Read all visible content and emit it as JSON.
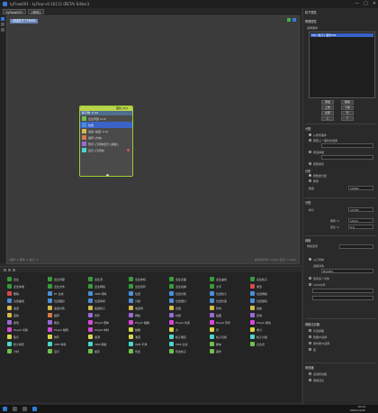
{
  "window": {
    "title": "tyFlow001 - tyFlow v0.16112 (BETA) Editor3",
    "min": "—",
    "max": "□",
    "close": "✕"
  },
  "menu": {
    "tabs": [
      "tyFlow001",
      "[修改]"
    ]
  },
  "graph": {
    "crumb": "创建粒子 TYBIRD",
    "status_left": "操作: 0  事件: 1  粒子: 0",
    "status_right": "操作运行时: 0.000s  显示: 0.000s"
  },
  "node": {
    "header": "事件_001",
    "subheader": "粒子数: 0 (0)",
    "rows": [
      {
        "label": "出生局部 (0-0)",
        "color": "#6fbf4a",
        "sel": false
      },
      {
        "label": "位置",
        "color": "#4a8fd6",
        "sel": true
      },
      {
        "label": "速度 (速度: 0.0)",
        "color": "#d6b84a",
        "sel": false
      },
      {
        "label": "旋转 (方向)",
        "color": "#d67a4a",
        "sel": false
      },
      {
        "label": "形状 (几何体显示 [基础])",
        "color": "#9a6ad6",
        "sel": false
      },
      {
        "label": "显示 (几何体)",
        "color": "#4ad6c8",
        "sel": false
      }
    ]
  },
  "right": {
    "sec1": "粒子属性",
    "sec2": "物理属性",
    "list_header": "选择事件:",
    "list_items": [
      "001 (粒子) 事件001"
    ],
    "btn_add": "添加",
    "btn_remove": "删除",
    "btn_up": "上移",
    "btn_down": "下移",
    "btn_all": "全部",
    "btn_none": "无",
    "btn_a": "上",
    "btn_b": "下",
    "sec3": "分配",
    "opt_a": "从所有事件",
    "opt_b": "按照上一事件的选择",
    "opt_c": "按选择组",
    "opt_d": "按照排序",
    "sec4": "分布",
    "dist_a": "按数量分配",
    "dist_b": "概率",
    "lbl_count": "数量",
    "val_count": "10000",
    "sec5": "分配",
    "lbl_seed": "种子",
    "val_seed": "12345",
    "lbl_prob": "概率 %",
    "val_prob": "100.0",
    "lbl_var": "变化 %",
    "val_var": "0.0",
    "sec6": "网格",
    "mesh_hdr": "网格选项",
    "mesh_a": "从几何体",
    "mesh_b": "选择对象",
    "mesh_field": "Box001",
    "mesh_c": "使用多个对象",
    "mesh_d": "mtlib文件",
    "sec7": "网格过滤器",
    "f1": "仅选择面",
    "f2": "按面ID选择",
    "f3": "按材质ID选择",
    "f4": "组",
    "sec8": "修改器",
    "m1": "应用修改器",
    "m2": "保留顶点"
  },
  "ops": [
    {
      "label": "出生",
      "c": "#3a9a3a"
    },
    {
      "label": "出生局部",
      "c": "#3a9a3a"
    },
    {
      "label": "出生流",
      "c": "#3a9a3a"
    },
    {
      "label": "出生体积",
      "c": "#3a9a3a"
    },
    {
      "label": "出生表面",
      "c": "#3a9a3a"
    },
    {
      "label": "出生曲线",
      "c": "#3a9a3a"
    },
    {
      "label": "出生粒子",
      "c": "#3a9a3a"
    },
    {
      "label": "出生体素",
      "c": "#3a9a3a"
    },
    {
      "label": "出生文件",
      "c": "#3a9a3a"
    },
    {
      "label": "出生网格",
      "c": "#3a9a3a"
    },
    {
      "label": "出生形状",
      "c": "#3a9a3a"
    },
    {
      "label": "出生绘制",
      "c": "#3a9a3a"
    },
    {
      "label": "文字",
      "c": "#3a9a3a"
    },
    {
      "label": "重置",
      "c": "#d64a4a"
    },
    {
      "label": "删除",
      "c": "#d64a4a"
    },
    {
      "label": "PT 生成",
      "c": "#4a8fd6"
    },
    {
      "label": "VDB 转换",
      "c": "#4a8fd6"
    },
    {
      "label": "位置",
      "c": "#4a8fd6"
    },
    {
      "label": "位置对象",
      "c": "#4a8fd6"
    },
    {
      "label": "位置粒子",
      "c": "#4a8fd6"
    },
    {
      "label": "位置网格",
      "c": "#4a8fd6"
    },
    {
      "label": "位置曲线",
      "c": "#4a8fd6"
    },
    {
      "label": "位置图标",
      "c": "#4a8fd6"
    },
    {
      "label": "位置体积",
      "c": "#4a8fd6"
    },
    {
      "label": "分组",
      "c": "#4a8fd6"
    },
    {
      "label": "位置细分",
      "c": "#4a8fd6"
    },
    {
      "label": "位置约束",
      "c": "#4a8fd6"
    },
    {
      "label": "位置随机",
      "c": "#4a8fd6"
    },
    {
      "label": "速度",
      "c": "#d6b84a"
    },
    {
      "label": "速度对象",
      "c": "#d6b84a"
    },
    {
      "label": "速度粒子",
      "c": "#d6b84a"
    },
    {
      "label": "速度场",
      "c": "#d6b84a"
    },
    {
      "label": "自旋",
      "c": "#d6b84a"
    },
    {
      "label": "转向",
      "c": "#d6b84a"
    },
    {
      "label": "缩放",
      "c": "#d6b84a"
    },
    {
      "label": "变换",
      "c": "#d6b84a"
    },
    {
      "label": "旋转",
      "c": "#d67a4a"
    },
    {
      "label": "形状",
      "c": "#9a6ad6"
    },
    {
      "label": "网格",
      "c": "#9a6ad6"
    },
    {
      "label": "材质",
      "c": "#9a6ad6"
    },
    {
      "label": "贴图",
      "c": "#9a6ad6"
    },
    {
      "label": "实例",
      "c": "#9a6ad6"
    },
    {
      "label": "颜色",
      "c": "#9a6ad6"
    },
    {
      "label": "属性",
      "c": "#9a6ad6"
    },
    {
      "label": "PhysX 刚体",
      "c": "#d64ad6"
    },
    {
      "label": "PhysX 碰撞",
      "c": "#d64ad6"
    },
    {
      "label": "PhysX 约束",
      "c": "#d64ad6"
    },
    {
      "label": "PhysX 形状",
      "c": "#d64ad6"
    },
    {
      "label": "PhysX 属性",
      "c": "#d64ad6"
    },
    {
      "label": "PhysX 切换",
      "c": "#d64ad6"
    },
    {
      "label": "PhysX 破碎",
      "c": "#d64ad6"
    },
    {
      "label": "PhysX 布料",
      "c": "#d64ad6"
    },
    {
      "label": "碰撞",
      "c": "#d6d64a"
    },
    {
      "label": "力",
      "c": "#d6d64a"
    },
    {
      "label": "风",
      "c": "#d6d64a"
    },
    {
      "label": "重力",
      "c": "#d6d64a"
    },
    {
      "label": "吸引",
      "c": "#d6d64a"
    },
    {
      "label": "排斥",
      "c": "#d6d64a"
    },
    {
      "label": "漩涡",
      "c": "#d6d64a"
    },
    {
      "label": "湍流",
      "c": "#d6d64a"
    },
    {
      "label": "粒子绑定",
      "c": "#4ad6c8"
    },
    {
      "label": "粒子切换",
      "c": "#4ad6c8"
    },
    {
      "label": "粒子分组",
      "c": "#4ad6c8"
    },
    {
      "label": "粒子排序",
      "c": "#4ad6c8"
    },
    {
      "label": "VDB 体积",
      "c": "#4ad6c8"
    },
    {
      "label": "VDB 网格",
      "c": "#4ad6c8"
    },
    {
      "label": "VDB 平滑",
      "c": "#4ad6c8"
    },
    {
      "label": "VDB 过滤",
      "c": "#4ad6c8"
    },
    {
      "label": "脚本",
      "c": "#6fbf4a"
    },
    {
      "label": "表达式",
      "c": "#6fbf4a"
    },
    {
      "label": "计时",
      "c": "#6fbf4a"
    },
    {
      "label": "显示",
      "c": "#6fbf4a"
    },
    {
      "label": "缓存",
      "c": "#6fbf4a"
    },
    {
      "label": "导出",
      "c": "#6fbf4a"
    },
    {
      "label": "导出粒子",
      "c": "#6fbf4a"
    },
    {
      "label": "事件",
      "c": "#6fbf4a"
    }
  ],
  "taskbar": {
    "time": "10:24",
    "date": "2022/11/20"
  }
}
